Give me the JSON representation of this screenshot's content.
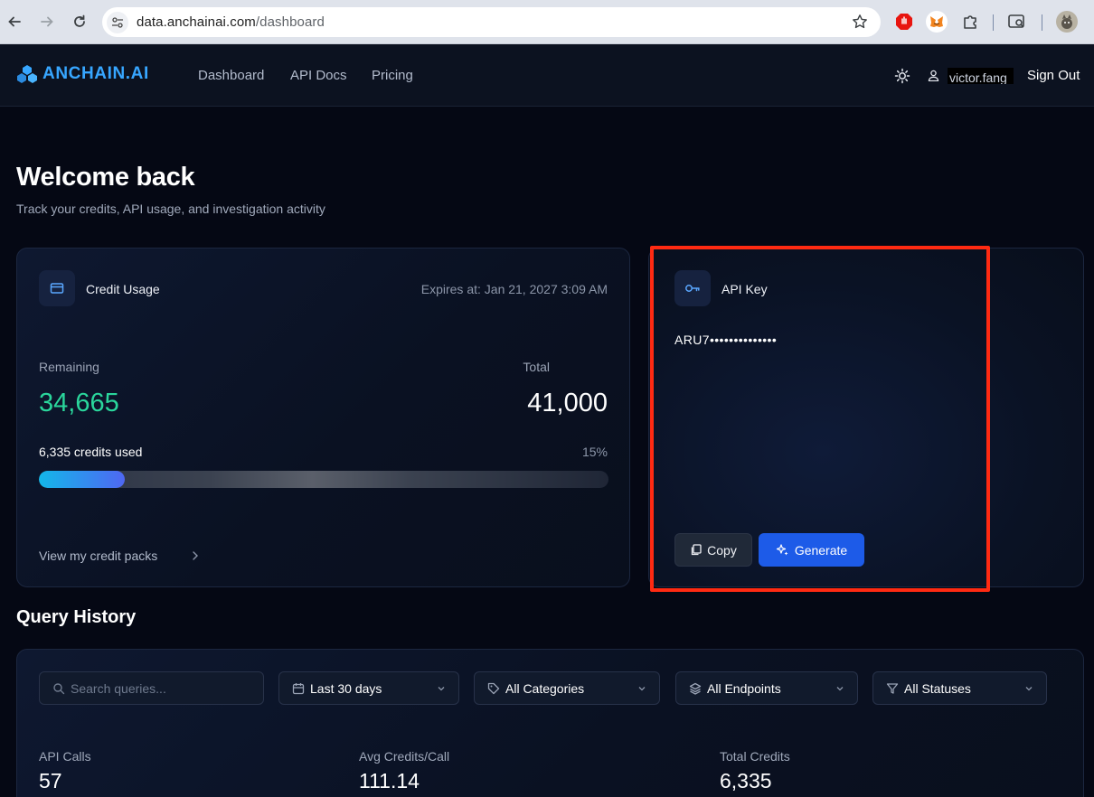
{
  "browser": {
    "url_domain": "data.anchainai.com",
    "url_path": "/dashboard"
  },
  "header": {
    "logo_text": "ANCHAIN.AI",
    "nav": [
      "Dashboard",
      "API Docs",
      "Pricing"
    ],
    "username": "victor.fang",
    "sign_out": "Sign Out"
  },
  "page": {
    "title": "Welcome back",
    "subtitle": "Track your credits, API usage, and investigation activity"
  },
  "credit_usage": {
    "title": "Credit Usage",
    "expires": "Expires at: Jan 21, 2027 3:09 AM",
    "remaining_label": "Remaining",
    "remaining_value": "34,665",
    "total_label": "Total",
    "total_value": "41,000",
    "used_text": "6,335 credits used",
    "used_percent_text": "15%",
    "used_fraction": 0.15,
    "view_packs": "View my credit packs"
  },
  "api_key": {
    "title": "API Key",
    "value": "ARU7••••••••••••••",
    "copy_label": "Copy",
    "generate_label": "Generate"
  },
  "query_history": {
    "title": "Query History",
    "search_placeholder": "Search queries...",
    "date_filter": "Last 30 days",
    "category_filter": "All Categories",
    "endpoint_filter": "All Endpoints",
    "status_filter": "All Statuses",
    "stats": [
      {
        "label": "API Calls",
        "value": "57"
      },
      {
        "label": "Avg Credits/Call",
        "value": "111.14"
      },
      {
        "label": "Total Credits",
        "value": "6,335"
      }
    ]
  },
  "colors": {
    "accent_green": "#2ad69c",
    "brand_blue": "#37a6ff",
    "button_blue": "#1d5be8",
    "highlight_red": "#ff2a12"
  }
}
